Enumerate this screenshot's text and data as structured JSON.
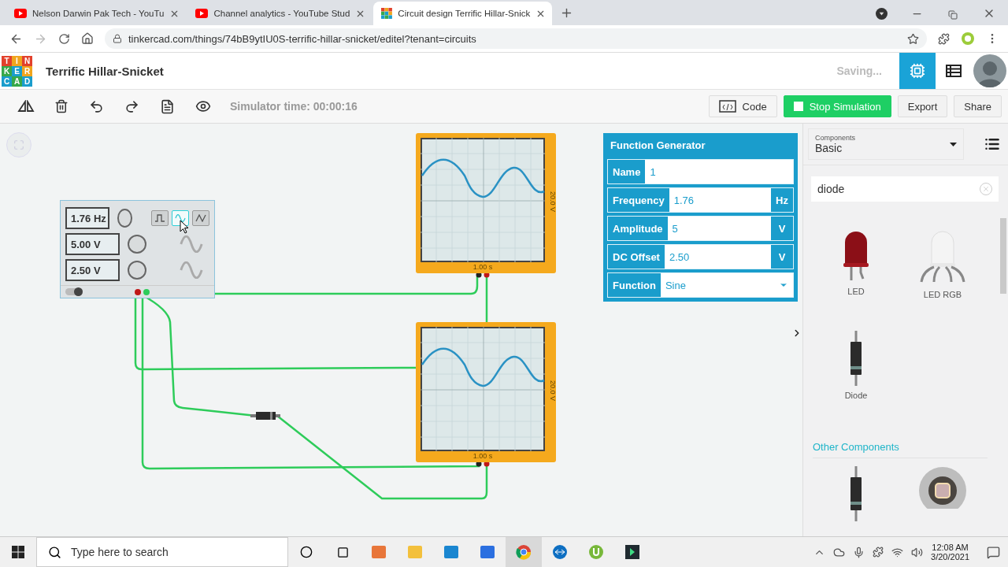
{
  "browser": {
    "tabs": [
      {
        "title": "Nelson Darwin Pak Tech - YouTu",
        "kind": "youtube",
        "selected": false
      },
      {
        "title": "Channel analytics - YouTube Stud",
        "kind": "youtube",
        "selected": false
      },
      {
        "title": "Circuit design Terrific Hillar-Snick",
        "kind": "tinkercad",
        "selected": true
      }
    ],
    "url": "tinkercad.com/things/74bB9ytIU0S-terrific-hillar-snicket/editel?tenant=circuits"
  },
  "header": {
    "logo_letters": [
      "T",
      "I",
      "N",
      "K",
      "E",
      "R",
      "C",
      "A",
      "D"
    ],
    "title": "Terrific Hillar-Snicket",
    "status": "Saving..."
  },
  "toolbar": {
    "simulator_time": "Simulator time: 00:00:16",
    "buttons": [
      {
        "label": "Code",
        "kind": "code"
      },
      {
        "label": "Stop Simulation",
        "kind": "primary"
      },
      {
        "label": "Export",
        "kind": "plain"
      },
      {
        "label": "Share",
        "kind": "plain"
      }
    ]
  },
  "function_generator": {
    "power_on": true,
    "displays": [
      "1.76 Hz",
      "5.00 V",
      "2.50 V"
    ],
    "waveforms": [
      {
        "kind": "square",
        "selected": false
      },
      {
        "kind": "sine",
        "selected": true
      },
      {
        "kind": "triangle",
        "selected": false
      }
    ]
  },
  "oscilloscopes": [
    {
      "time_label": "1.00 s",
      "volt_label": "20.0 V"
    },
    {
      "time_label": "1.00 s",
      "volt_label": "20.0 V"
    }
  ],
  "inspector": {
    "title": "Function Generator",
    "fields": [
      {
        "label": "Name",
        "value": "1",
        "kind": "text"
      },
      {
        "label": "Frequency",
        "value": "1.76",
        "unit": "Hz",
        "kind": "text"
      },
      {
        "label": "Amplitude",
        "value": "5",
        "unit": "V",
        "kind": "text"
      },
      {
        "label": "DC Offset",
        "value": "2.50",
        "unit": "V",
        "kind": "text"
      },
      {
        "label": "Function",
        "value": "Sine",
        "kind": "select"
      }
    ]
  },
  "components_panel": {
    "category_label": "Components",
    "category": "Basic",
    "search": "diode",
    "items": [
      {
        "label": "LED",
        "kind": "led"
      },
      {
        "label": "LED RGB",
        "kind": "led_rgb"
      },
      {
        "label": "Diode",
        "kind": "diode"
      }
    ],
    "section": "Other Components",
    "more_items": [
      {
        "kind": "diode"
      },
      {
        "kind": "pushbutton"
      }
    ]
  },
  "taskbar": {
    "search_placeholder": "Type here to search",
    "time": "12:08 AM",
    "date": "3/20/2021"
  }
}
